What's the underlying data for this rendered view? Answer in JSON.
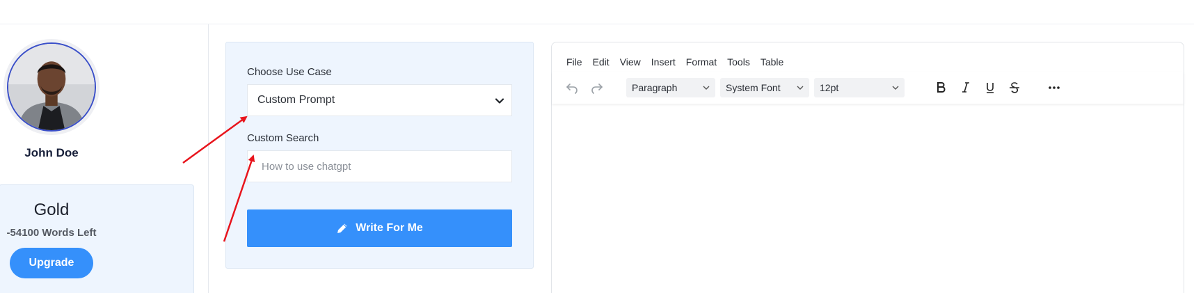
{
  "user": {
    "name": "John Doe"
  },
  "plan": {
    "name": "Gold",
    "words_left": "-54100 Words Left",
    "upgrade_label": "Upgrade"
  },
  "form": {
    "use_case_label": "Choose Use Case",
    "use_case_value": "Custom Prompt",
    "search_label": "Custom Search",
    "search_placeholder": "How to use chatgpt",
    "submit_label": "Write For Me"
  },
  "editor": {
    "menu": [
      "File",
      "Edit",
      "View",
      "Insert",
      "Format",
      "Tools",
      "Table"
    ],
    "block_format": "Paragraph",
    "font_family": "System Font",
    "font_size": "12pt",
    "icons": [
      "undo-icon",
      "redo-icon",
      "bold-icon",
      "italic-icon",
      "underline-icon",
      "strikethrough-icon",
      "more-icon"
    ]
  },
  "colors": {
    "accent": "#3590fb",
    "panel": "#eef5fe",
    "annotation": "#e8141c"
  }
}
